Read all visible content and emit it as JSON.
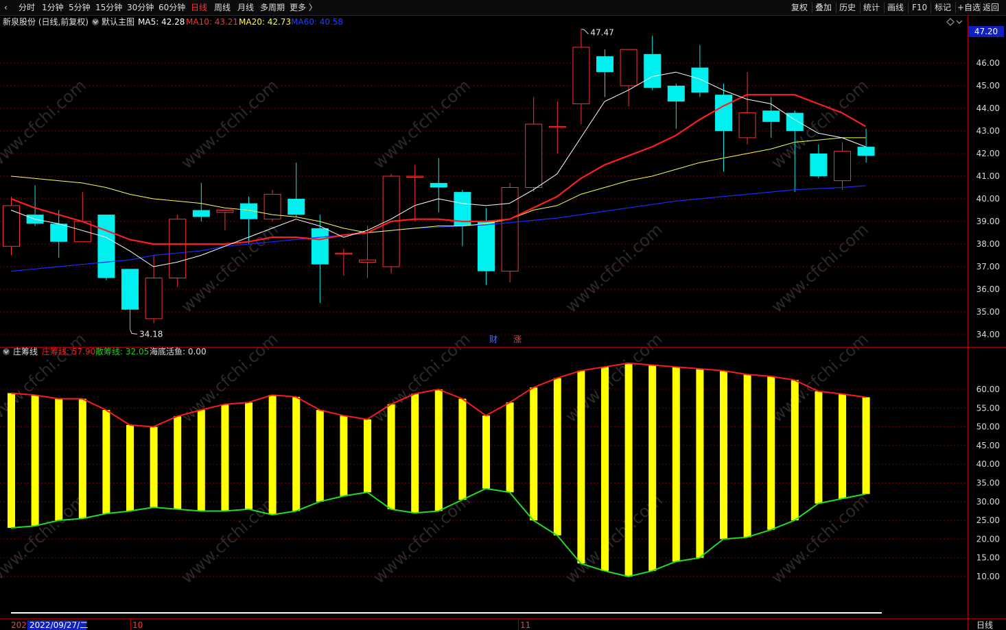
{
  "toolbar": {
    "back_glyph": "‹",
    "periods": [
      "分时",
      "1分钟",
      "5分钟",
      "15分钟",
      "30分钟",
      "60分钟",
      "日线",
      "周线",
      "月线",
      "多周期",
      "更多 〉"
    ],
    "active_period": "日线",
    "right_buttons": [
      "复权",
      "叠加",
      "历史",
      "统计",
      "画线",
      "F10",
      "标记",
      "+自选",
      "返回"
    ]
  },
  "main_header": {
    "stock": "新泉股份 (日线,前复权)",
    "template": "默认主图",
    "ma": [
      {
        "label": "MA5: 42.28",
        "color": "#ffffff"
      },
      {
        "label": "MA10: 43.21",
        "color": "#ff3030"
      },
      {
        "label": "MA20: 42.73",
        "color": "#ffff40"
      },
      {
        "label": "MA60: 40.58",
        "color": "#2040ff"
      }
    ]
  },
  "sub_header": {
    "name": "庄筹线",
    "items": [
      {
        "label": "庄筹线: 57.90",
        "color": "#ff2020"
      },
      {
        "label": "散筹线: 32.05",
        "color": "#20d020"
      },
      {
        "label": "海底活鱼: 0.00",
        "color": "#e0e0e0"
      }
    ]
  },
  "price_badge": "47.20",
  "high_label": "47.47",
  "low_label": "34.18",
  "markers": {
    "cai": "财",
    "zhang": "涨"
  },
  "bottom": {
    "year_fragment": "2022",
    "date_label": "2022/09/27/二",
    "month_oct": "10",
    "month_nov": "11",
    "period_label": "日线"
  },
  "watermark": "www.cfchi.com",
  "colors": {
    "up": "#ff3232",
    "down": "#00f0f0",
    "grid": "#7a0000",
    "ma5": "#ffffff",
    "ma10": "#ff1e1e",
    "ma20": "#ffff50",
    "ma60": "#1c2cff",
    "bar": "#ffff00",
    "zhuang": "#ff1a1a",
    "san": "#22dd22"
  },
  "chart_data": [
    {
      "type": "candlestick",
      "title": "新泉股份 (日线,前复权)",
      "y_ticks": [
        34.0,
        35.0,
        36.0,
        37.0,
        38.0,
        39.0,
        40.0,
        41.0,
        42.0,
        43.0,
        44.0,
        45.0,
        46.0
      ],
      "ylim": [
        33.5,
        48.0
      ],
      "candles": [
        {
          "o": 37.9,
          "h": 40.1,
          "l": 37.5,
          "c": 39.7
        },
        {
          "o": 39.3,
          "h": 40.6,
          "l": 38.8,
          "c": 38.9
        },
        {
          "o": 38.9,
          "h": 39.5,
          "l": 37.4,
          "c": 38.1
        },
        {
          "o": 38.1,
          "h": 40.3,
          "l": 38.1,
          "c": 39.0
        },
        {
          "o": 39.3,
          "h": 39.3,
          "l": 36.4,
          "c": 36.5
        },
        {
          "o": 36.9,
          "h": 36.9,
          "l": 34.2,
          "c": 35.1
        },
        {
          "o": 34.7,
          "h": 37.5,
          "l": 34.5,
          "c": 36.5
        },
        {
          "o": 36.5,
          "h": 39.3,
          "l": 36.1,
          "c": 39.1
        },
        {
          "o": 39.5,
          "h": 40.7,
          "l": 39.0,
          "c": 39.2
        },
        {
          "o": 39.4,
          "h": 39.5,
          "l": 38.6,
          "c": 39.5
        },
        {
          "o": 39.8,
          "h": 40.1,
          "l": 38.0,
          "c": 39.1
        },
        {
          "o": 39.1,
          "h": 40.4,
          "l": 39.0,
          "c": 40.2
        },
        {
          "o": 40.0,
          "h": 41.6,
          "l": 39.2,
          "c": 39.3
        },
        {
          "o": 38.7,
          "h": 39.3,
          "l": 35.4,
          "c": 37.1
        },
        {
          "o": 37.6,
          "h": 37.8,
          "l": 36.6,
          "c": 37.6
        },
        {
          "o": 37.2,
          "h": 38.8,
          "l": 36.5,
          "c": 37.3
        },
        {
          "o": 37.0,
          "h": 41.1,
          "l": 36.7,
          "c": 41.0
        },
        {
          "o": 41.0,
          "h": 41.5,
          "l": 39.0,
          "c": 41.0
        },
        {
          "o": 40.7,
          "h": 41.8,
          "l": 39.4,
          "c": 40.5
        },
        {
          "o": 40.3,
          "h": 40.4,
          "l": 37.9,
          "c": 38.8
        },
        {
          "o": 39.0,
          "h": 39.6,
          "l": 36.2,
          "c": 36.8
        },
        {
          "o": 36.8,
          "h": 40.7,
          "l": 36.3,
          "c": 40.5
        },
        {
          "o": 40.5,
          "h": 44.5,
          "l": 40.3,
          "c": 43.3
        },
        {
          "o": 43.2,
          "h": 44.3,
          "l": 42.0,
          "c": 43.2
        },
        {
          "o": 44.2,
          "h": 47.5,
          "l": 43.3,
          "c": 46.7
        },
        {
          "o": 46.3,
          "h": 46.6,
          "l": 44.5,
          "c": 45.6
        },
        {
          "o": 45.0,
          "h": 46.6,
          "l": 44.1,
          "c": 46.6
        },
        {
          "o": 46.4,
          "h": 47.2,
          "l": 44.8,
          "c": 44.9
        },
        {
          "o": 45.0,
          "h": 45.1,
          "l": 43.1,
          "c": 44.3
        },
        {
          "o": 45.8,
          "h": 46.8,
          "l": 44.5,
          "c": 44.7
        },
        {
          "o": 44.6,
          "h": 45.1,
          "l": 41.2,
          "c": 43.0
        },
        {
          "o": 42.7,
          "h": 45.6,
          "l": 42.4,
          "c": 43.8
        },
        {
          "o": 43.9,
          "h": 44.5,
          "l": 42.7,
          "c": 43.4
        },
        {
          "o": 43.8,
          "h": 43.9,
          "l": 40.3,
          "c": 43.0
        },
        {
          "o": 42.0,
          "h": 42.4,
          "l": 40.9,
          "c": 41.0
        },
        {
          "o": 40.8,
          "h": 42.5,
          "l": 40.4,
          "c": 42.1
        },
        {
          "o": 42.3,
          "h": 43.1,
          "l": 41.6,
          "c": 41.9
        }
      ],
      "ma5": [
        39.5,
        39.1,
        38.9,
        38.6,
        38.3,
        37.7,
        37.0,
        37.2,
        37.5,
        37.9,
        38.3,
        38.7,
        39.1,
        38.8,
        38.3,
        38.6,
        39.1,
        39.7,
        40.0,
        39.8,
        39.7,
        39.8,
        40.4,
        41.1,
        42.7,
        44.3,
        44.8,
        45.4,
        45.6,
        45.3,
        44.8,
        44.4,
        44.2,
        43.5,
        42.9,
        42.7,
        42.3
      ],
      "ma10": [
        40.0,
        39.6,
        39.3,
        39.0,
        38.6,
        38.2,
        38.0,
        38.0,
        38.0,
        38.0,
        38.1,
        38.3,
        38.3,
        38.2,
        38.4,
        38.5,
        39.0,
        39.1,
        39.1,
        39.0,
        39.0,
        39.1,
        39.6,
        40.1,
        40.9,
        41.5,
        41.9,
        42.3,
        42.8,
        43.5,
        44.1,
        44.6,
        44.6,
        44.6,
        44.2,
        43.8,
        43.2
      ],
      "ma20": [
        41.0,
        40.9,
        40.8,
        40.7,
        40.5,
        40.2,
        40.0,
        39.9,
        39.8,
        39.6,
        39.5,
        39.3,
        39.2,
        39.0,
        38.7,
        38.5,
        38.6,
        38.7,
        38.8,
        38.8,
        38.9,
        39.1,
        39.5,
        39.7,
        40.2,
        40.5,
        40.8,
        41.0,
        41.3,
        41.6,
        41.8,
        42.0,
        42.2,
        42.5,
        42.6,
        42.7,
        42.7
      ],
      "ma60": [
        36.8,
        36.9,
        37.0,
        37.1,
        37.2,
        37.3,
        37.5,
        37.6,
        37.7,
        37.9,
        38.0,
        38.1,
        38.2,
        38.3,
        38.4,
        38.5,
        38.6,
        38.7,
        38.75,
        38.8,
        38.85,
        38.95,
        39.05,
        39.15,
        39.3,
        39.45,
        39.6,
        39.75,
        39.9,
        40.0,
        40.1,
        40.2,
        40.3,
        40.4,
        40.45,
        40.5,
        40.58
      ]
    },
    {
      "type": "bar",
      "title": "庄筹线",
      "y_ticks": [
        10,
        15,
        20,
        25,
        30,
        35,
        40,
        45,
        50,
        55,
        60
      ],
      "ylim": [
        5,
        68
      ],
      "series": [
        {
          "name": "庄筹线",
          "values": [
            59.0,
            58.5,
            57.5,
            57.5,
            54.5,
            50.5,
            50.0,
            52.8,
            54.5,
            56.0,
            56.5,
            58.5,
            58.0,
            54.5,
            53.0,
            52.0,
            56.0,
            58.8,
            60.0,
            57.5,
            53.0,
            56.5,
            60.5,
            63.0,
            65.0,
            66.0,
            67.0,
            66.5,
            66.0,
            65.5,
            65.0,
            64.0,
            63.5,
            62.5,
            59.5,
            58.8,
            57.9
          ]
        },
        {
          "name": "散筹线",
          "values": [
            23.0,
            23.5,
            25.0,
            25.5,
            26.8,
            27.5,
            28.5,
            28.0,
            27.5,
            27.5,
            28.0,
            26.5,
            27.5,
            30.0,
            31.5,
            32.5,
            28.0,
            27.0,
            27.5,
            30.5,
            33.5,
            32.5,
            25.0,
            21.0,
            13.5,
            11.5,
            10.0,
            11.5,
            14.0,
            15.0,
            20.0,
            20.5,
            22.5,
            25.0,
            29.5,
            30.8,
            32.05
          ]
        },
        {
          "name": "海底活鱼",
          "values": [
            0,
            0,
            0,
            0,
            0,
            0,
            0,
            0,
            0,
            0,
            0,
            0,
            0,
            0,
            0,
            0,
            0,
            0,
            0,
            0,
            0,
            0,
            0,
            0,
            0,
            0,
            0,
            0,
            0,
            0,
            0,
            0,
            0,
            0,
            0,
            0,
            0
          ]
        }
      ]
    }
  ]
}
